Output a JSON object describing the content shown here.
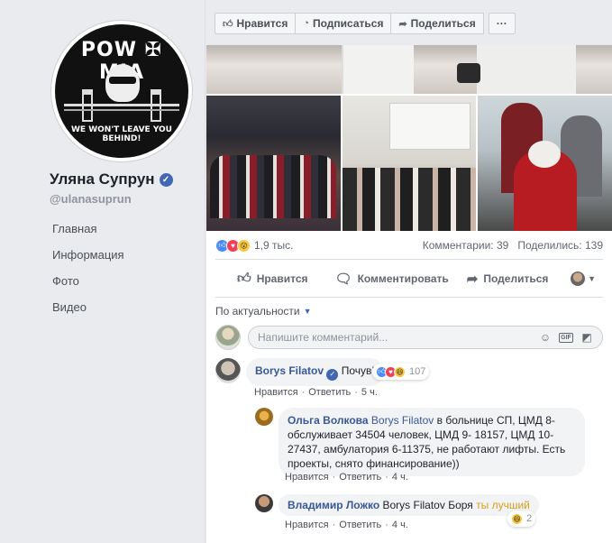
{
  "sidebar": {
    "logo": {
      "top_text": "POW ✠ MIA",
      "bottom_text": "WE WON'T LEAVE YOU BEHIND!"
    },
    "page_name": "Уляна Супрун",
    "handle": "@ulanasuprun",
    "nav": [
      "Главная",
      "Информация",
      "Фото",
      "Видео"
    ]
  },
  "topbar": {
    "like": "Нравится",
    "follow": "Подписаться",
    "share": "Поделиться",
    "more": "···"
  },
  "post": {
    "reactions_count": "1,9 тыс.",
    "comments_count": "Комментарии: 39",
    "shares_count": "Поделились: 139",
    "actions": {
      "like": "Нравится",
      "comment": "Комментировать",
      "share": "Поделиться"
    },
    "sort_label": "По актуальности",
    "composer_placeholder": "Напишите комментарий...",
    "composer_gif": "GIF"
  },
  "comments": [
    {
      "author": "Borys Filatov",
      "text": "Почув!",
      "reactions": "107",
      "meta": {
        "like": "Нравится",
        "reply": "Ответить",
        "time": "5 ч."
      }
    },
    {
      "author": "Ольга Волкова",
      "mention": "Borys Filatov",
      "text": " в больнице СП, ЦМД 8-обслуживает 34504 человек, ЦМД 9- 18157, ЦМД 10-27437, амбулатория 6-11375, не работают лифты. Есть проекты, снято финансирование))",
      "meta": {
        "like": "Нравится",
        "reply": "Ответить",
        "time": "4 ч."
      }
    },
    {
      "author": "Владимир Ложко",
      "mention": "Borys Filatov",
      "text_plain": " Боря ",
      "text_highlight": "ты лучший",
      "reactions": "2",
      "meta": {
        "like": "Нравится",
        "reply": "Ответить",
        "time": "4 ч."
      }
    }
  ],
  "colors": {
    "brand": "#4267b2",
    "link": "#385898",
    "background": "#e9ebee"
  }
}
